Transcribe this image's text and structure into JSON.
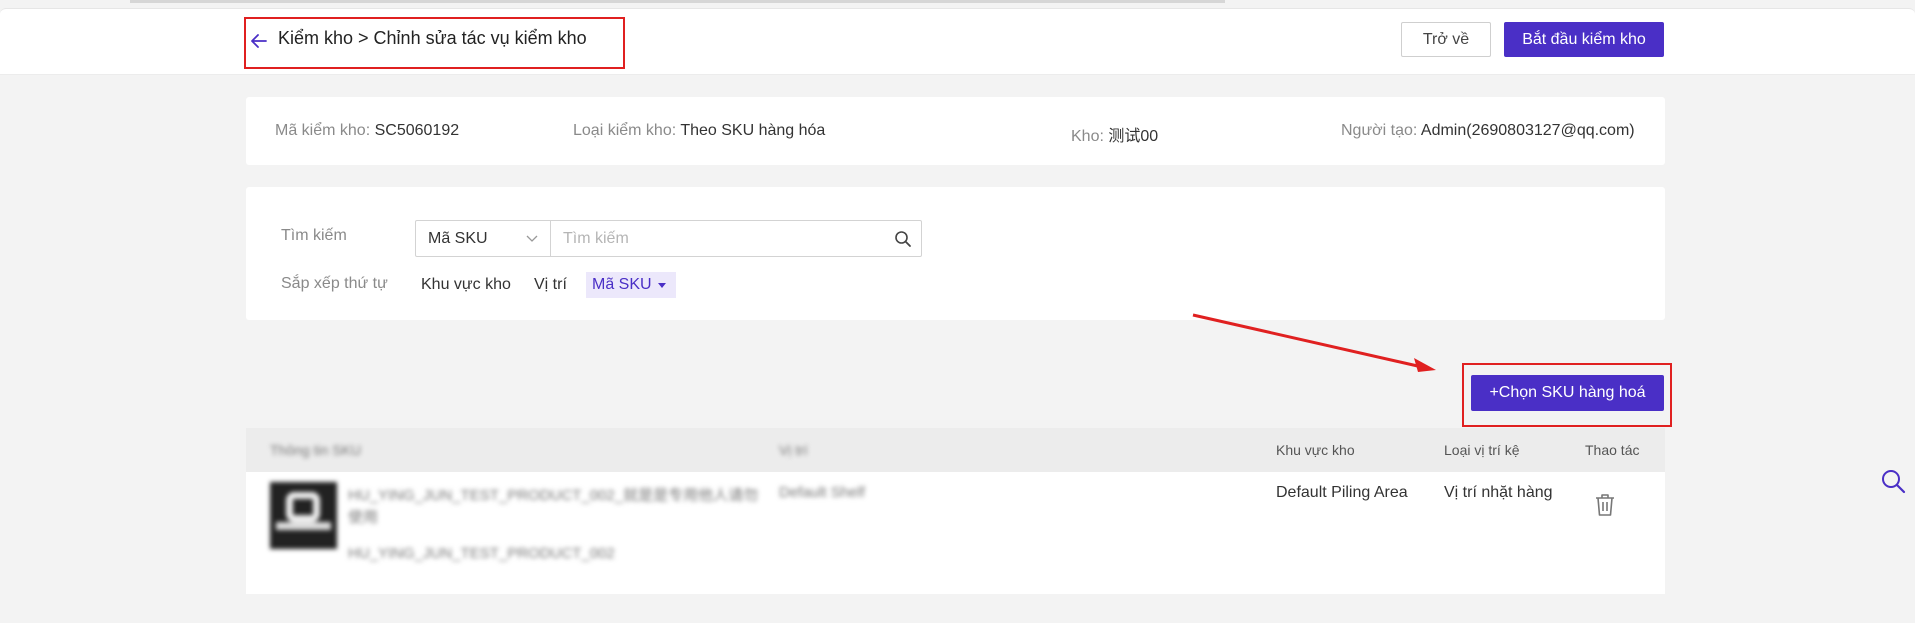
{
  "header": {
    "breadcrumb": "Kiểm kho > Chỉnh sửa tác vụ kiểm kho",
    "back_button": "Trở về",
    "start_button": "Bắt đầu kiểm kho"
  },
  "info": {
    "code_label": "Mã kiểm kho: ",
    "code_value": "SC5060192",
    "type_label": "Loại kiểm kho: ",
    "type_value": "Theo SKU hàng hóa",
    "warehouse_label": "Kho: ",
    "warehouse_value": "测试00",
    "creator_label": "Người tạo: ",
    "creator_value": "Admin(2690803127@qq.com)"
  },
  "filter": {
    "search_label": "Tìm kiếm",
    "search_type": "Mã SKU",
    "search_placeholder": "Tìm kiếm",
    "sort_label": "Sắp xếp thứ tự",
    "sort_options": [
      "Khu vực kho",
      "Vị trí"
    ],
    "sort_active": "Mã SKU"
  },
  "actions": {
    "choose_sku": "+Chọn SKU hàng hoá"
  },
  "table": {
    "columns": [
      "Thông tin SKU",
      "Vị trí",
      "Khu vực kho",
      "Loại vị trí kệ",
      "Thao tác"
    ],
    "rows": [
      {
        "sku_name_line1": "HU_YING_JUN_TEST_PRODUCT_002_就是是专用他人请勿",
        "sku_name_line2": "使用",
        "sku_code": "HU_YING_JUN_TEST_PRODUCT_002",
        "location": "Default Shelf",
        "area": "Default Piling Area",
        "shelf_type": "Vị trí nhặt hàng"
      }
    ]
  },
  "colors": {
    "primary": "#4a2fc6",
    "highlight_red": "#e02020"
  }
}
